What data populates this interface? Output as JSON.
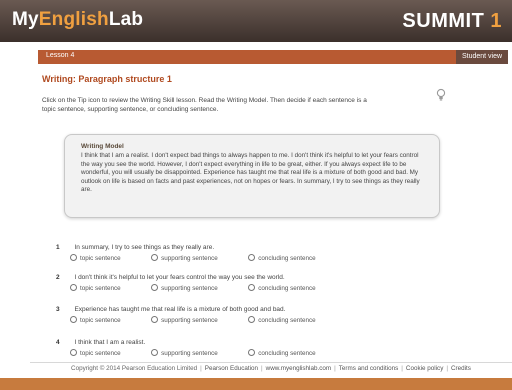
{
  "header": {
    "brand_prefix": "My",
    "brand_accent": "English",
    "brand_suffix": "Lab",
    "series": "SUMMIT",
    "level": "1"
  },
  "lessonbar": {
    "label": "Lesson 4",
    "student_view": "Student view"
  },
  "page": {
    "title": "Writing: Paragraph structure 1",
    "instructions": "Click on the Tip icon to review the Writing Skill lesson. Read the Writing Model. Then decide if each sentence is a topic sentence, supporting sentence, or concluding sentence."
  },
  "model": {
    "title": "Writing Model",
    "text": "I think that I am a realist. I don't expect bad things to always happen to me. I don't think it's helpful to let your fears control the way you see the world. However, I don't expect everything in life to be great, either. If you always expect life to be wonderful, you will usually be disappointed. Experience has taught me that real life is a mixture of both good and bad. My outlook on life is based on facts and past experiences, not on hopes or fears. In summary, I try to see things as they really are."
  },
  "option_labels": [
    "topic sentence",
    "supporting sentence",
    "concluding sentence"
  ],
  "questions": [
    {
      "num": "1",
      "text": "In summary, I try to see things as they really are."
    },
    {
      "num": "2",
      "text": "I don't think it's helpful to let your fears control the way you see the world."
    },
    {
      "num": "3",
      "text": "Experience has taught me that real life is a mixture of both good and bad."
    },
    {
      "num": "4",
      "text": "I think that I am a realist."
    }
  ],
  "footer": {
    "copyright": "Copyright © 2014 Pearson Education Limited",
    "company": "Pearson Education",
    "site": "www.myenglishlab.com",
    "terms": "Terms and conditions",
    "cookie": "Cookie policy",
    "credits": "Credits"
  },
  "colors": {
    "header_bg": "#3b302b",
    "accent_orange": "#f0a040",
    "lesson_bar": "#b85a32",
    "title_red": "#b04a20"
  },
  "icons": {
    "tip": "lightbulb-icon"
  }
}
